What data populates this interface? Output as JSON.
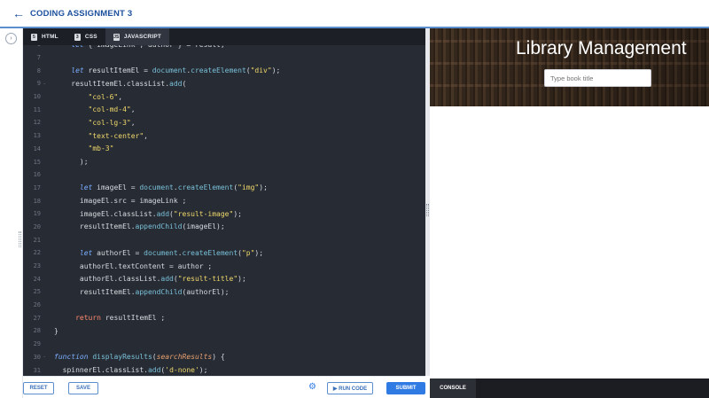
{
  "header": {
    "back_icon": "arrow-left-icon",
    "title": "CODING ASSIGNMENT 3"
  },
  "editor_tabs": [
    {
      "label": "HTML",
      "icon": "html5-icon"
    },
    {
      "label": "CSS",
      "icon": "css3-icon"
    },
    {
      "label": "JAVASCRIPT",
      "icon": "js-icon"
    }
  ],
  "code_lines": [
    {
      "n": "6",
      "fold": "",
      "html": "    <span class=\"k\">let</span> { imageLink , author } = result;"
    },
    {
      "n": "7",
      "fold": "",
      "html": ""
    },
    {
      "n": "8",
      "fold": "",
      "html": "    <span class=\"k\">let</span> resultItemEl = <span class=\"f\">document</span>.<span class=\"f\">createElement</span>(<span class=\"s\">\"div\"</span>);"
    },
    {
      "n": "9",
      "fold": "-",
      "html": "    resultItemEl.classList.<span class=\"f\">add</span>("
    },
    {
      "n": "10",
      "fold": "",
      "html": "        <span class=\"s\">\"col-6\"</span>,"
    },
    {
      "n": "11",
      "fold": "",
      "html": "        <span class=\"s\">\"col-md-4\"</span>,"
    },
    {
      "n": "12",
      "fold": "",
      "html": "        <span class=\"s\">\"col-lg-3\"</span>,"
    },
    {
      "n": "13",
      "fold": "",
      "html": "        <span class=\"s\">\"text-center\"</span>,"
    },
    {
      "n": "14",
      "fold": "",
      "html": "        <span class=\"s\">\"mb-3\"</span>"
    },
    {
      "n": "15",
      "fold": "",
      "html": "      );"
    },
    {
      "n": "16",
      "fold": "",
      "html": ""
    },
    {
      "n": "17",
      "fold": "",
      "html": "      <span class=\"k\">let</span> imageEl = <span class=\"f\">document</span>.<span class=\"f\">createElement</span>(<span class=\"s\">\"img\"</span>);"
    },
    {
      "n": "18",
      "fold": "",
      "html": "      imageEl.src = imageLink ;"
    },
    {
      "n": "19",
      "fold": "",
      "html": "      imageEl.classList.<span class=\"f\">add</span>(<span class=\"s\">\"result-image\"</span>);"
    },
    {
      "n": "20",
      "fold": "",
      "html": "      resultItemEl.<span class=\"f\">appendChild</span>(imageEl);"
    },
    {
      "n": "21",
      "fold": "",
      "html": ""
    },
    {
      "n": "22",
      "fold": "",
      "html": "      <span class=\"k\">let</span> authorEl = <span class=\"f\">document</span>.<span class=\"f\">createElement</span>(<span class=\"s\">\"p\"</span>);"
    },
    {
      "n": "23",
      "fold": "",
      "html": "      authorEl.textContent = author ;"
    },
    {
      "n": "24",
      "fold": "",
      "html": "      authorEl.classList.<span class=\"f\">add</span>(<span class=\"s\">\"result-title\"</span>);"
    },
    {
      "n": "25",
      "fold": "",
      "html": "      resultItemEl.<span class=\"f\">appendChild</span>(authorEl);"
    },
    {
      "n": "26",
      "fold": "",
      "html": ""
    },
    {
      "n": "27",
      "fold": "",
      "html": "     <span class=\"r\">return</span> resultItemEl ;"
    },
    {
      "n": "28",
      "fold": "",
      "html": "}"
    },
    {
      "n": "29",
      "fold": "",
      "html": ""
    },
    {
      "n": "30",
      "fold": "-",
      "html": "<span class=\"k\">function</span> <span class=\"f\">displayResults</span>(<span class=\"p\">searchResults</span>) {"
    },
    {
      "n": "31",
      "fold": "",
      "html": "  spinnerEl.classList.<span class=\"f\">add</span>(<span class=\"s\">'d-none'</span>);"
    }
  ],
  "bottom": {
    "reset_label": "RESET",
    "save_label": "SAVE",
    "settings_icon": "gear-icon",
    "run_label": "▶ RUN CODE",
    "submit_label": "SUBMIT"
  },
  "preview": {
    "heading": "Library Management",
    "search_placeholder": "Type book title",
    "console_label": "CONSOLE"
  },
  "colors": {
    "accent": "#2f7be3",
    "header_text": "#1b4f9c",
    "editor_bg": "#272b33"
  }
}
